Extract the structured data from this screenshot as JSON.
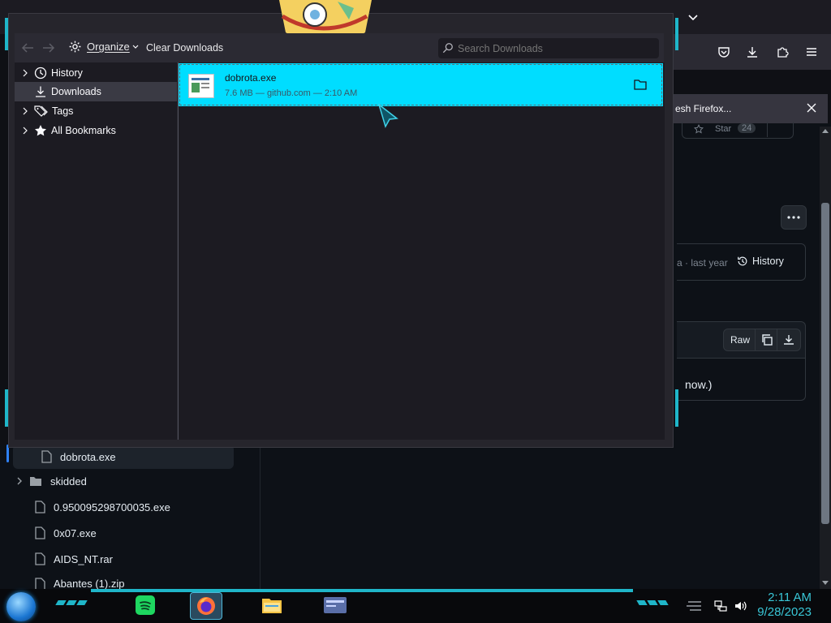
{
  "library": {
    "back_tooltip": "Go back",
    "organize_label": "Organize",
    "clear_label": "Clear Downloads",
    "search_placeholder": "Search Downloads",
    "sidebar": [
      {
        "label": "History",
        "icon": "clock-icon",
        "expandable": true
      },
      {
        "label": "Downloads",
        "icon": "download-icon",
        "expandable": false,
        "selected": true
      },
      {
        "label": "Tags",
        "icon": "tags-icon",
        "expandable": true
      },
      {
        "label": "All Bookmarks",
        "icon": "star-icon",
        "expandable": true
      }
    ],
    "download": {
      "filename": "dobrota.exe",
      "details": "7.6 MB — github.com — 2:10 AM"
    }
  },
  "browser": {
    "notice_text": "esh Firefox...",
    "star_label": "Star",
    "star_count": "24",
    "commit_text": "a · last year",
    "history_label": "History",
    "raw_label": "Raw",
    "body_text": "now.)"
  },
  "file_tree": [
    {
      "label": "dobrota.exe",
      "type": "file",
      "active": true
    },
    {
      "label": "skidded",
      "type": "folder"
    },
    {
      "label": "0.950095298700035.exe",
      "type": "file"
    },
    {
      "label": "0x07.exe",
      "type": "file"
    },
    {
      "label": "AIDS_NT.rar",
      "type": "file"
    },
    {
      "label": "Abantes (1).zip",
      "type": "file"
    }
  ],
  "taskbar": {
    "time": "2:11 AM",
    "date": "9/28/2023",
    "apps": [
      "spotify-icon",
      "firefox-icon",
      "file-explorer-icon",
      "app-window-icon"
    ]
  },
  "colors": {
    "accent": "#00ddff",
    "taskbar_accent": "#1fb6c9",
    "panel": "#1c1b22"
  }
}
